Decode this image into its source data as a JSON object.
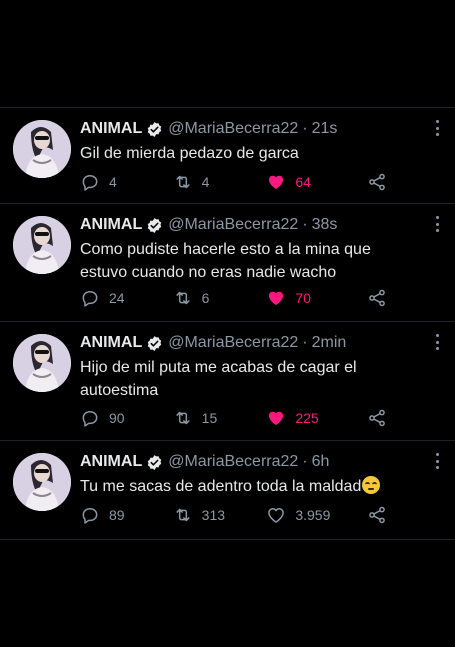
{
  "tweets": [
    {
      "name": "ANIMAL",
      "handle": "@MariaBecerra22",
      "separator": "·",
      "time": "21s",
      "text": "Gil de mierda pedazo de garca",
      "replies": "4",
      "retweets": "4",
      "likes": "64",
      "liked": true
    },
    {
      "name": "ANIMAL",
      "handle": "@MariaBecerra22",
      "separator": "·",
      "time": "38s",
      "text": "Como pudiste hacerle esto a la mina que estuvo cuando no eras nadie wacho",
      "replies": "24",
      "retweets": "6",
      "likes": "70",
      "liked": true
    },
    {
      "name": "ANIMAL",
      "handle": "@MariaBecerra22",
      "separator": "·",
      "time": "2min",
      "text": "Hijo de mil puta me acabas de cagar el autoestima",
      "replies": "90",
      "retweets": "15",
      "likes": "225",
      "liked": true
    },
    {
      "name": "ANIMAL",
      "handle": "@MariaBecerra22",
      "separator": "·",
      "time": "6h",
      "text": "Tu me sacas de adentro toda la maldad",
      "emoji": "face-with-rolling-eyes",
      "replies": "89",
      "retweets": "313",
      "likes": "3.959",
      "liked": false
    }
  ],
  "colors": {
    "background": "#000000",
    "text": "#e7e9ea",
    "secondary": "#8b98a5",
    "like_active": "#f91880",
    "divider": "#1f2327"
  },
  "icons": [
    "verified-icon",
    "more-icon",
    "reply-icon",
    "retweet-icon",
    "heart-icon",
    "share-icon"
  ]
}
